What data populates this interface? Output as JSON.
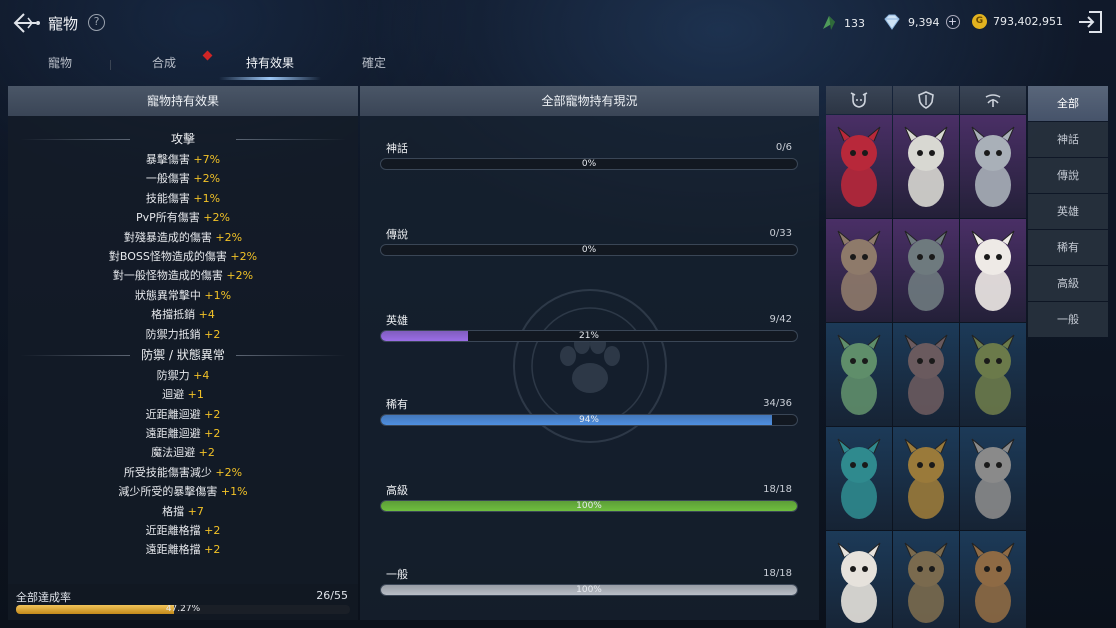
{
  "header": {
    "title": "寵物",
    "help_label": "?"
  },
  "currency": {
    "crystal": "133",
    "diamond": "9,394",
    "gold": "793,402,951",
    "gold_icon_label": "G"
  },
  "tabs": [
    {
      "label": "寵物",
      "active": false
    },
    {
      "label": "合成",
      "active": false
    },
    {
      "label": "持有效果",
      "active": true
    },
    {
      "label": "確定",
      "active": false
    }
  ],
  "left": {
    "title": "寵物持有效果",
    "attack_title": "攻擊",
    "attack": [
      {
        "name": "暴擊傷害",
        "value": "+7%"
      },
      {
        "name": "一般傷害",
        "value": "+2%"
      },
      {
        "name": "技能傷害",
        "value": "+1%"
      },
      {
        "name": "PvP所有傷害",
        "value": "+2%"
      },
      {
        "name": "對殘暴造成的傷害",
        "value": "+2%"
      },
      {
        "name": "對BOSS怪物造成的傷害",
        "value": "+2%"
      },
      {
        "name": "對一般怪物造成的傷害",
        "value": "+2%"
      },
      {
        "name": "狀態異常擊中",
        "value": "+1%"
      },
      {
        "name": "格擋抵銷",
        "value": "+4"
      },
      {
        "name": "防禦力抵銷",
        "value": "+2"
      }
    ],
    "defense_title": "防禦 / 狀態異常",
    "defense": [
      {
        "name": "防禦力",
        "value": "+4"
      },
      {
        "name": "迴避",
        "value": "+1"
      },
      {
        "name": "近距離迴避",
        "value": "+2"
      },
      {
        "name": "遠距離迴避",
        "value": "+2"
      },
      {
        "name": "魔法迴避",
        "value": "+2"
      },
      {
        "name": "所受技能傷害減少",
        "value": "+2%"
      },
      {
        "name": "減少所受的暴擊傷害",
        "value": "+1%"
      },
      {
        "name": "格擋",
        "value": "+7"
      },
      {
        "name": "近距離格擋",
        "value": "+2"
      },
      {
        "name": "遠距離格擋",
        "value": "+2"
      }
    ],
    "achievement": {
      "label": "全部達成率",
      "count": "26/55",
      "percent_label": "47.27%",
      "fraction": 0.4727
    }
  },
  "mid": {
    "title": "全部寵物持有現況",
    "rarities": [
      {
        "name": "神話",
        "count": "0/6",
        "percent_label": "0%",
        "fraction": 0,
        "color": "#777777"
      },
      {
        "name": "傳說",
        "count": "0/33",
        "percent_label": "0%",
        "fraction": 0,
        "color": "#777777"
      },
      {
        "name": "英雄",
        "count": "9/42",
        "percent_label": "21%",
        "fraction": 0.21,
        "color": "#9b6ee6"
      },
      {
        "name": "稀有",
        "count": "34/36",
        "percent_label": "94%",
        "fraction": 0.94,
        "color": "#4f8fe0"
      },
      {
        "name": "高級",
        "count": "18/18",
        "percent_label": "100%",
        "fraction": 1,
        "color": "#6fbf3e"
      },
      {
        "name": "一般",
        "count": "18/18",
        "percent_label": "100%",
        "fraction": 1,
        "color": "#b9bec6"
      }
    ]
  },
  "pets": [
    {
      "icon": "red-beast-pet",
      "bg": "#4a2f66",
      "body": "#b8283a"
    },
    {
      "icon": "white-goat-pet",
      "bg": "#4a2f66",
      "body": "#d8d8d2"
    },
    {
      "icon": "armored-knight-pet",
      "bg": "#4a2f66",
      "body": "#a9b0b8"
    },
    {
      "icon": "horned-dragon-pet",
      "bg": "#4a2f66",
      "body": "#8e7a6a"
    },
    {
      "icon": "ghost-beast-pet",
      "bg": "#4a2f66",
      "body": "#6e7a7e"
    },
    {
      "icon": "white-rabbit-pet",
      "bg": "#4a2f66",
      "body": "#eeeae6"
    },
    {
      "icon": "green-dragon-pet",
      "bg": "#1c3a58",
      "body": "#5f8e6a"
    },
    {
      "icon": "helmet-warrior-pet",
      "bg": "#1c3a58",
      "body": "#6a5a5e"
    },
    {
      "icon": "flower-girl-pet",
      "bg": "#1c3a58",
      "body": "#6b7a4a"
    },
    {
      "icon": "teal-dog-pet",
      "bg": "#1c3a58",
      "body": "#2f8a8e"
    },
    {
      "icon": "golden-knight-pet",
      "bg": "#1c3a58",
      "body": "#9a7a3a"
    },
    {
      "icon": "tribal-mask-pet",
      "bg": "#1c3a58",
      "body": "#8a8a8a"
    },
    {
      "icon": "white-cat-pet",
      "bg": "#1c3a58",
      "body": "#e6e2dc"
    },
    {
      "icon": "bone-warrior-pet",
      "bg": "#1c3a58",
      "body": "#7a6a4e"
    },
    {
      "icon": "gold-helm-pet",
      "bg": "#1c3a58",
      "body": "#8e6a44"
    }
  ],
  "filters": [
    {
      "label": "全部",
      "active": true
    },
    {
      "label": "神話",
      "active": false
    },
    {
      "label": "傳說",
      "active": false
    },
    {
      "label": "英雄",
      "active": false
    },
    {
      "label": "稀有",
      "active": false
    },
    {
      "label": "高級",
      "active": false
    },
    {
      "label": "一般",
      "active": false
    }
  ],
  "colors": {
    "accent": "#f2c227",
    "panel_header": "#44505f"
  }
}
